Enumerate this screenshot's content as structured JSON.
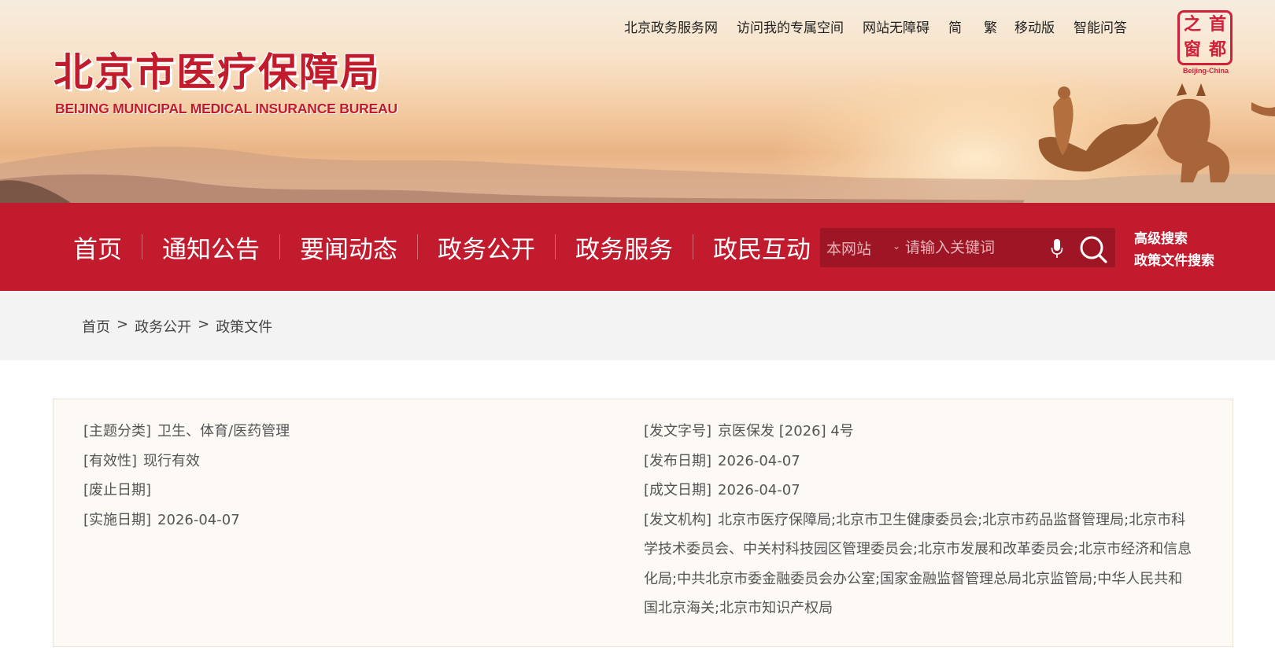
{
  "header": {
    "logo_cn": "北京市医疗保障局",
    "logo_en": "BEIJING MUNICIPAL MEDICAL INSURANCE BUREAU",
    "top_links": [
      "北京政务服务网",
      "访问我的专属空间",
      "网站无障碍",
      "简",
      "繁",
      "移动版",
      "智能问答"
    ],
    "capital_logo": {
      "chars": [
        "之",
        "首",
        "窗",
        "都"
      ],
      "en": "Beijing-China"
    }
  },
  "nav": {
    "items": [
      "首页",
      "通知公告",
      "要闻动态",
      "政务公开",
      "政务服务",
      "政民互动"
    ],
    "search": {
      "scope": "本网站",
      "placeholder": "请输入关键词",
      "mic_icon": "microphone-icon",
      "search_icon": "magnifier-icon"
    },
    "advanced": [
      "高级搜索",
      "政策文件搜索"
    ]
  },
  "breadcrumb": [
    "首页",
    "政务公开",
    "政策文件"
  ],
  "breadcrumb_separator": ">",
  "meta": {
    "left": [
      {
        "label": "[主题分类]",
        "value": "卫生、体育/医药管理"
      },
      {
        "label": "[有效性]",
        "value": "现行有效"
      },
      {
        "label": "[废止日期]",
        "value": ""
      },
      {
        "label": "[实施日期]",
        "value": "2026-04-07"
      }
    ],
    "right": [
      {
        "label": "[发文字号]",
        "value": "京医保发 [2026] 4号"
      },
      {
        "label": "[发布日期]",
        "value": "2026-04-07"
      },
      {
        "label": "[成文日期]",
        "value": "2026-04-07"
      },
      {
        "label": "[发文机构]",
        "value": "北京市医疗保障局;北京市卫生健康委员会;北京市药品监督管理局;北京市科学技术委员会、中关村科技园区管理委员会;北京市发展和改革委员会;北京市经济和信息化局;中共北京市委金融委员会办公室;国家金融监督管理总局北京监管局;中华人民共和国北京海关;北京市知识产权局"
      }
    ]
  },
  "colors": {
    "brand_red": "#c11b2d",
    "search_bg": "#9e1625",
    "breadcrumb_bg": "#f3f3f3",
    "meta_bg": "#fdf9f4"
  }
}
